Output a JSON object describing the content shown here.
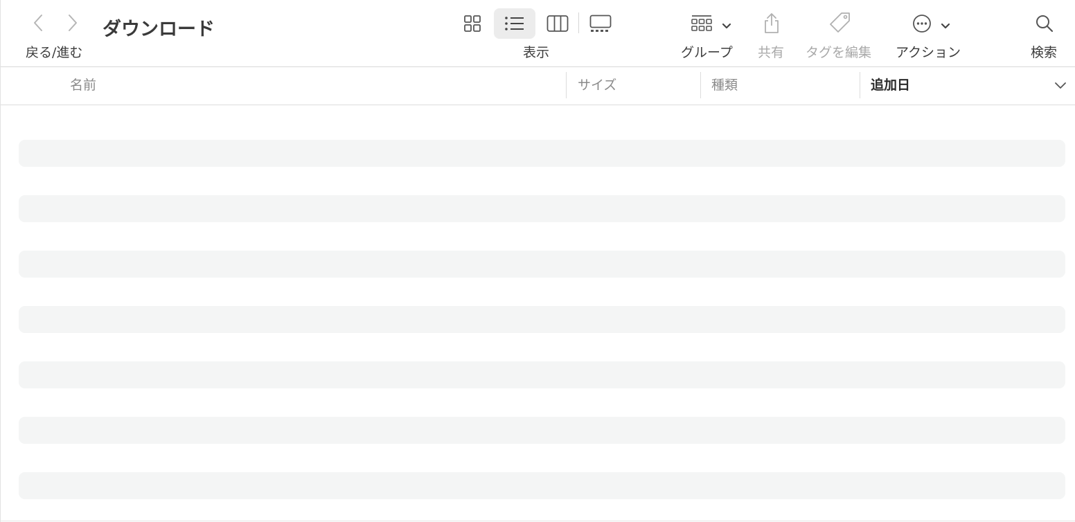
{
  "window": {
    "title": "ダウンロード"
  },
  "toolbar": {
    "nav_label": "戻る/進む",
    "view_label": "表示",
    "group_label": "グループ",
    "share_label": "共有",
    "tags_label": "タグを編集",
    "action_label": "アクション",
    "search_label": "検索",
    "selected_view": "list",
    "icons": {
      "back": "chevron-left-icon",
      "forward": "chevron-right-icon",
      "icon_view": "grid-icon",
      "list_view": "list-icon",
      "column_view": "columns-icon",
      "gallery_view": "gallery-icon",
      "group": "group-icon",
      "share": "share-icon",
      "tags": "tag-icon",
      "action": "ellipsis-circle-icon",
      "search": "magnifier-icon"
    }
  },
  "columns": {
    "name": "名前",
    "size": "サイズ",
    "kind": "種類",
    "date_added": "追加日",
    "sorted_by": "date_added"
  },
  "list": {
    "placeholder_rows": 7
  },
  "colors": {
    "placeholder": "#f4f5f5",
    "selected_view_bg": "#ececec",
    "disabled_text": "#a9a9a9"
  }
}
